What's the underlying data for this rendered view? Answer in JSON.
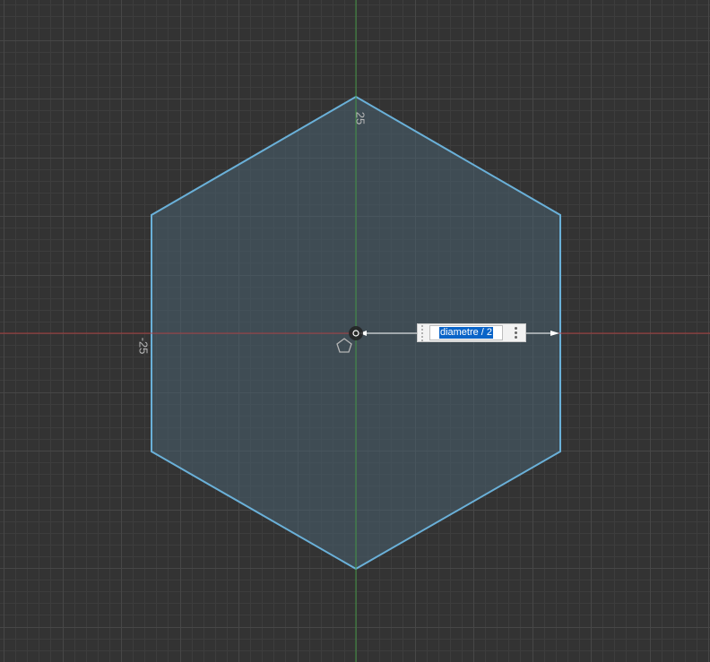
{
  "colors": {
    "background": "#333333",
    "grid_minor": "#3d3d3d",
    "grid_major": "#474747",
    "axis_x": "#c0393b",
    "axis_y": "#3f9a3f",
    "hexagon_stroke": "#6ab0d8",
    "hexagon_fill": "#48606f",
    "selection_highlight": "#0a64c8"
  },
  "rulers": {
    "top_label": "25",
    "left_label": "-25"
  },
  "sketch": {
    "shape": "hexagon",
    "tool_icon": "polygon-icon"
  },
  "dimension_input": {
    "value": "diametre / 2",
    "menu_icon": "vertical-ellipsis-icon",
    "grip_icon": "drag-grip-icon"
  }
}
